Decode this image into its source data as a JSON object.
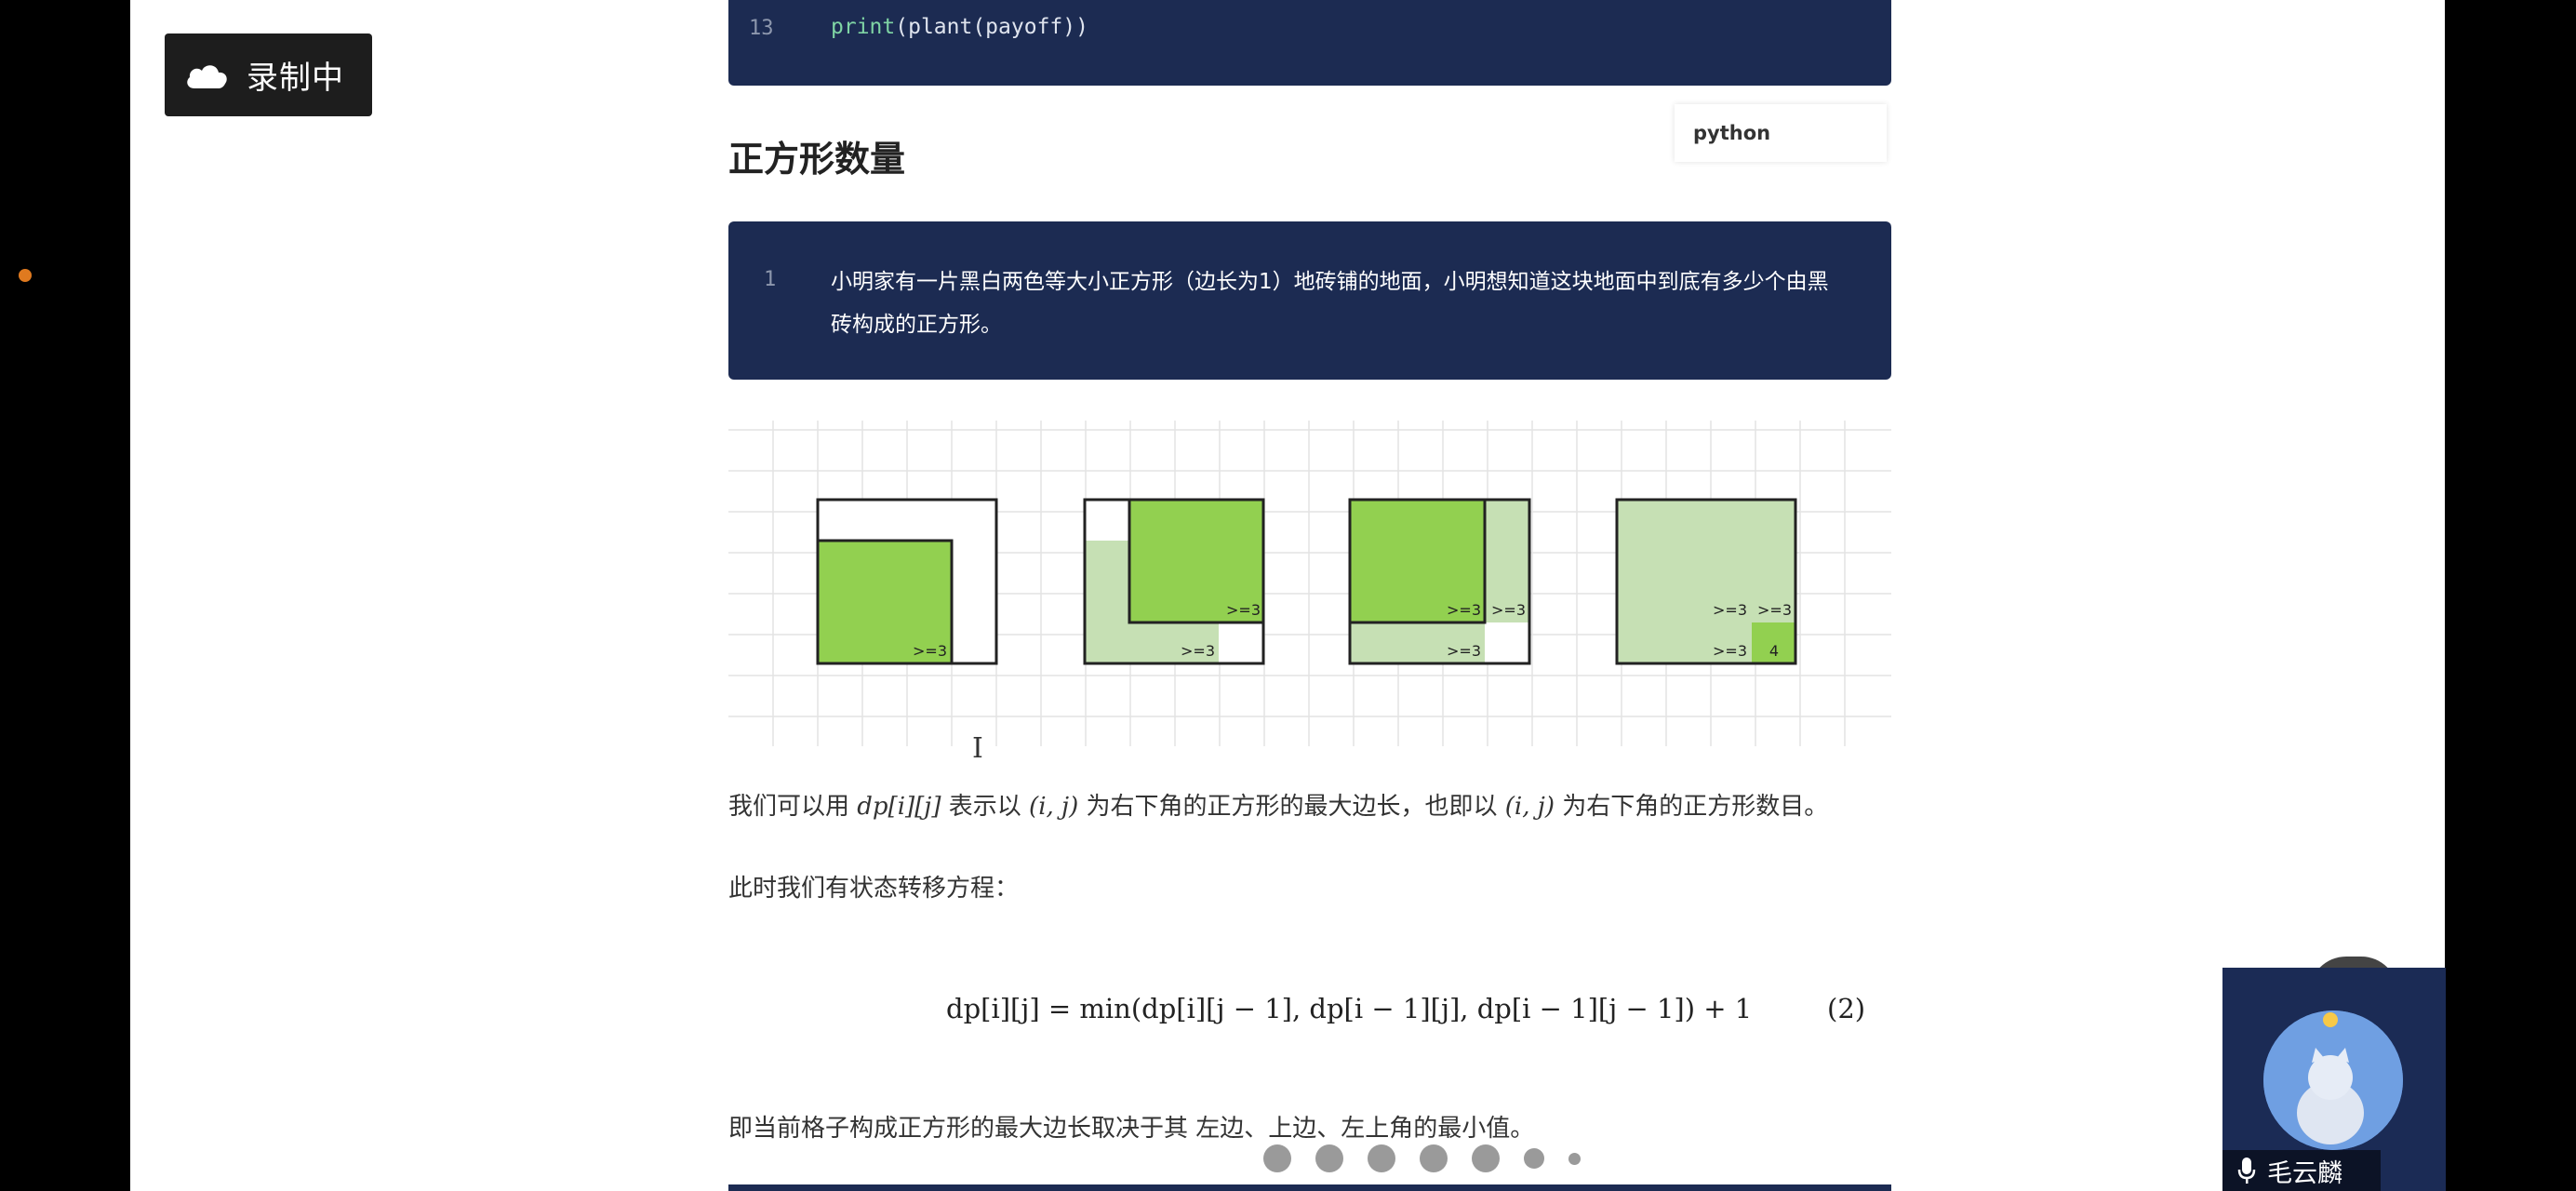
{
  "recording": {
    "label": "录制中",
    "icon": "cloud-icon"
  },
  "code_snippet": {
    "line_number": "13",
    "func": "print",
    "rest": "(plant(payoff))"
  },
  "section": {
    "title": "正方形数量",
    "language": "python"
  },
  "problem_block": {
    "line_number": "1",
    "text": "小明家有一片黑白两色等大小正方形（边长为1）地砖铺的地面，小明想知道这块地面中到底有多少个由黑砖构成的正方形。"
  },
  "figure": {
    "labels": {
      "ge3": ">=3",
      "four": "4"
    }
  },
  "paragraphs": {
    "p1_a": "我们可以用 ",
    "p1_m1": "dp[i][j]",
    "p1_b": " 表示以 ",
    "p1_m2": "(i, j)",
    "p1_c": " 为右下角的正方形的最大边长，也即以 ",
    "p1_m3": "(i, j)",
    "p1_d": " 为右下角的正方形数目。",
    "p2": "此时我们有状态转移方程：",
    "p3": "即当前格子构成正方形的最大边长取决于其 左边、上边、左上角的最小值。"
  },
  "formula": {
    "text": "dp[i][j] = min(dp[i][j − 1], dp[i − 1][j], dp[i − 1][j − 1]) + 1",
    "number": "(2)"
  },
  "participant": {
    "name": "毛云麟",
    "icon": "microphone-icon"
  },
  "colors": {
    "code_bg": "#1c2b52",
    "green_dark": "#92d050",
    "green_light": "#c6e0b4",
    "record_dot": "#e07a1f"
  }
}
